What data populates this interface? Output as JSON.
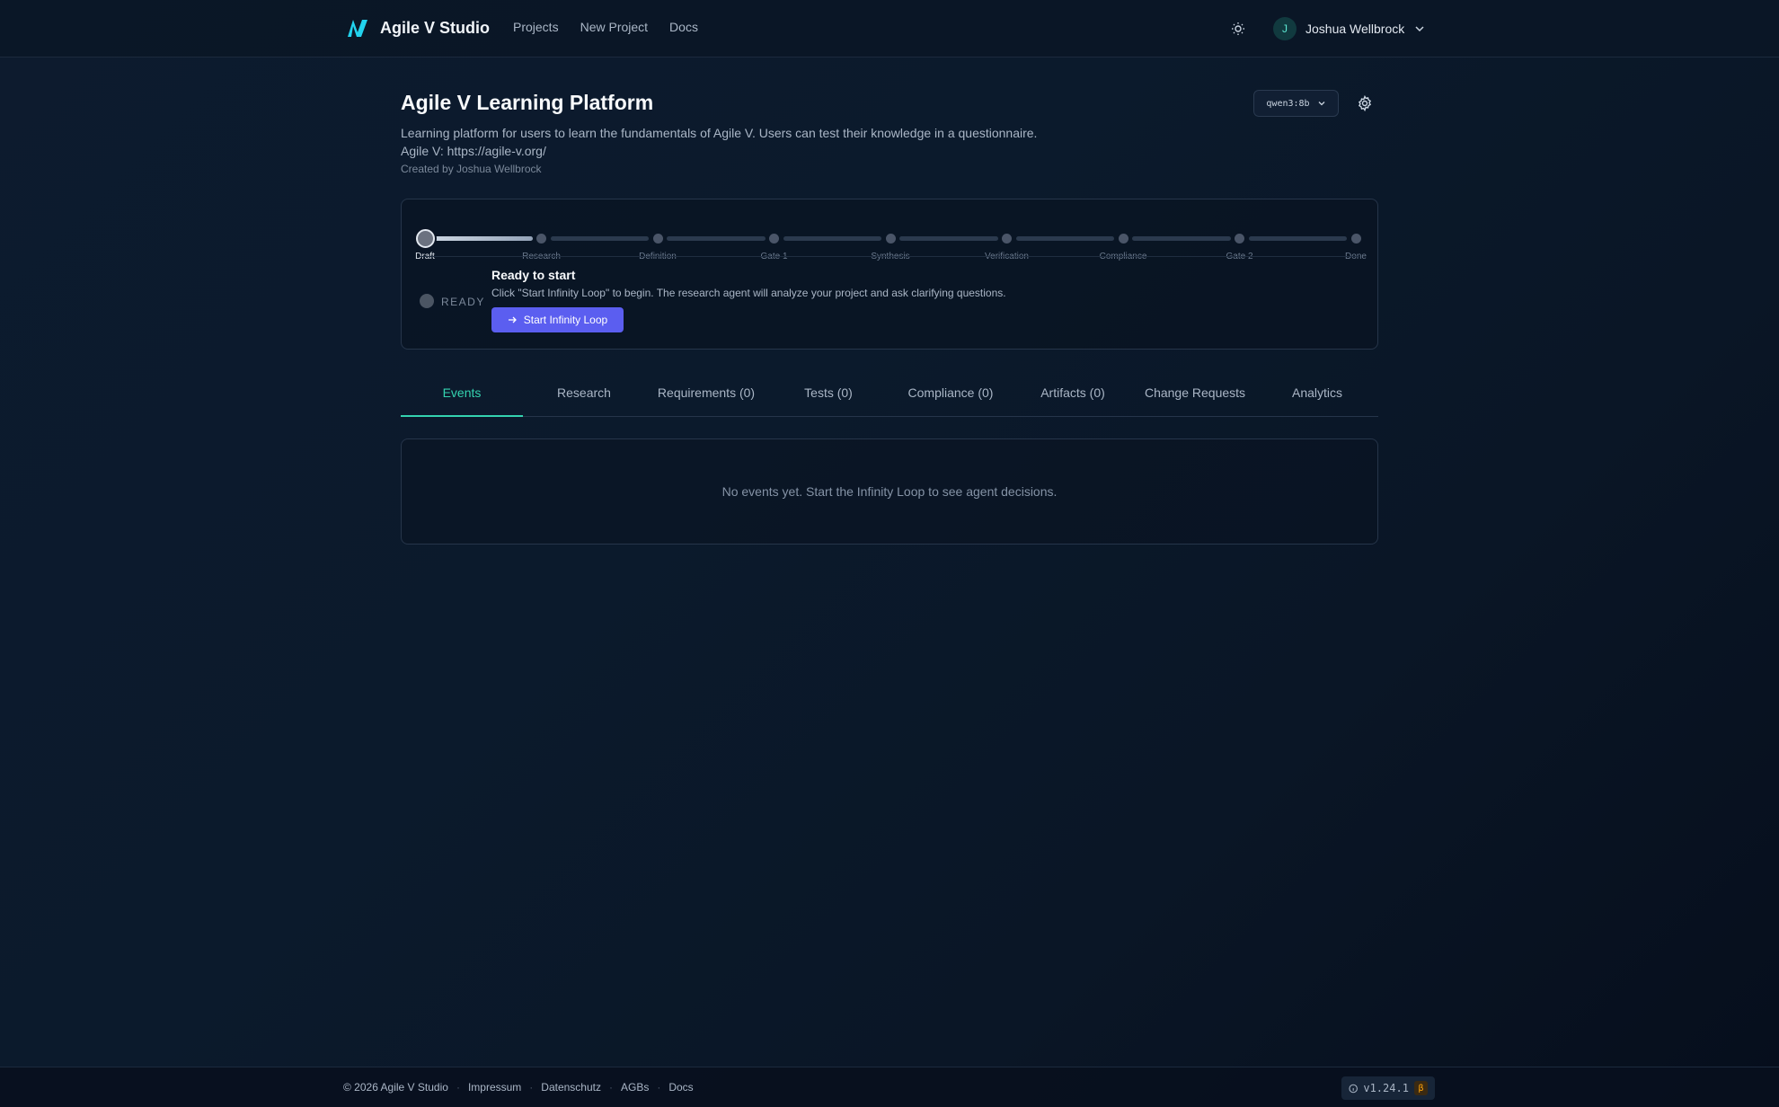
{
  "header": {
    "brand": "Agile V Studio",
    "nav": [
      "Projects",
      "New Project",
      "Docs"
    ],
    "user": {
      "initial": "J",
      "name": "Joshua Wellbrock"
    }
  },
  "project": {
    "title": "Agile V Learning Platform",
    "description_line1": "Learning platform for users to learn the fundamentals of Agile V. Users can test their knowledge in a questionnaire.",
    "description_line2": "Agile V: https://agile-v.org/",
    "created_by": "Created by Joshua Wellbrock",
    "model": "qwen3:8b"
  },
  "pipeline": {
    "stages": [
      "Draft",
      "Research",
      "Definition",
      "Gate 1",
      "Synthesis",
      "Verification",
      "Compliance",
      "Gate 2",
      "Done"
    ],
    "current_stage": "Draft",
    "status": "READY",
    "ready_title": "Ready to start",
    "ready_desc": "Click \"Start Infinity Loop\" to begin. The research agent will analyze your project and ask clarifying questions.",
    "start_button": "Start Infinity Loop"
  },
  "tabs": [
    "Events",
    "Research",
    "Requirements (0)",
    "Tests (0)",
    "Compliance (0)",
    "Artifacts (0)",
    "Change Requests",
    "Analytics"
  ],
  "active_tab": "Events",
  "events": {
    "empty_text": "No events yet. Start the Infinity Loop to see agent decisions."
  },
  "footer": {
    "copyright": "© 2026 Agile V Studio",
    "links": [
      "Impressum",
      "Datenschutz",
      "AGBs",
      "Docs"
    ],
    "version": "v1.24.1",
    "beta": "β"
  },
  "colors": {
    "accent": "#34d3b0",
    "primary_button": "#5b5ef0",
    "logo": "#22d3ee"
  }
}
